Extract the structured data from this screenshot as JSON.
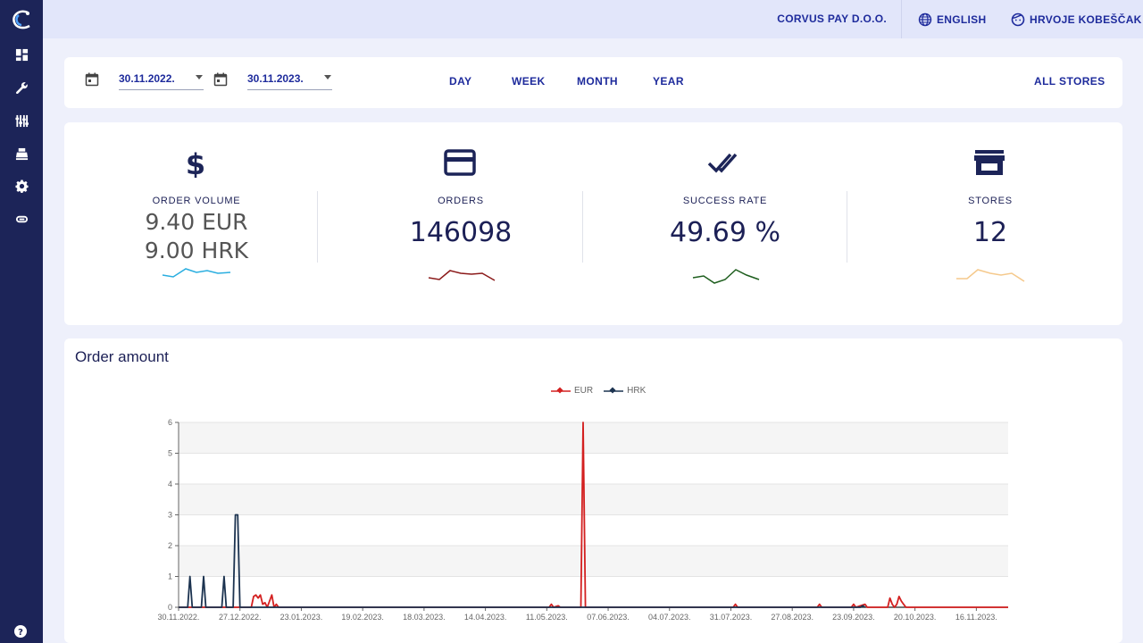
{
  "topbar": {
    "company": "CORVUS PAY D.O.O.",
    "language": "ENGLISH",
    "user": "HRVOJE KOBEŠČAK"
  },
  "sidebar": {
    "items": [
      {
        "name": "dashboard-icon"
      },
      {
        "name": "wrench-icon"
      },
      {
        "name": "sliders-icon"
      },
      {
        "name": "cash-register-icon"
      },
      {
        "name": "gear-icon"
      },
      {
        "name": "link-icon"
      }
    ],
    "help": "help-icon"
  },
  "filters": {
    "date_from": "30.11.2022.",
    "date_to": "30.11.2023.",
    "periods": [
      "DAY",
      "WEEK",
      "MONTH",
      "YEAR"
    ],
    "stores": "ALL STORES"
  },
  "stats": {
    "order_volume": {
      "label": "ORDER VOLUME",
      "value_eur": "9.40 EUR",
      "value_hrk": "9.00 HRK",
      "color": "#2aaee0"
    },
    "orders": {
      "label": "ORDERS",
      "value": "146098",
      "color": "#8b1a1a"
    },
    "success_rate": {
      "label": "SUCCESS RATE",
      "value": "49.69 %",
      "color": "#1e5e1e"
    },
    "stores": {
      "label": "STORES",
      "value": "12",
      "color": "#f5c98c"
    }
  },
  "chart": {
    "title": "Order amount"
  },
  "chart_data": {
    "type": "line",
    "legend": [
      "EUR",
      "HRK"
    ],
    "legend_position": "top-center",
    "ylim": [
      0,
      6
    ],
    "yticks": [
      0,
      1,
      2,
      3,
      4,
      5,
      6
    ],
    "x_tick_labels": [
      "30.11.2022.",
      "27.12.2022.",
      "23.01.2023.",
      "19.02.2023.",
      "18.03.2023.",
      "14.04.2023.",
      "11.05.2023.",
      "07.06.2023.",
      "04.07.2023.",
      "31.07.2023.",
      "27.08.2023.",
      "23.09.2023.",
      "20.10.2023.",
      "16.11.2023."
    ],
    "series": [
      {
        "name": "EUR",
        "color": "#d32020",
        "points": [
          [
            "2022-11-30",
            0
          ],
          [
            "2023-01-01",
            0
          ],
          [
            "2023-01-02",
            0.35
          ],
          [
            "2023-01-03",
            0.4
          ],
          [
            "2023-01-04",
            0.3
          ],
          [
            "2023-01-05",
            0.4
          ],
          [
            "2023-01-06",
            0.1
          ],
          [
            "2023-01-07",
            0.15
          ],
          [
            "2023-01-08",
            0
          ],
          [
            "2023-01-10",
            0.4
          ],
          [
            "2023-01-11",
            0
          ],
          [
            "2023-01-12",
            0.1
          ],
          [
            "2023-01-13",
            0
          ],
          [
            "2023-05-12",
            0
          ],
          [
            "2023-05-13",
            0.1
          ],
          [
            "2023-05-14",
            0
          ],
          [
            "2023-05-16",
            0.05
          ],
          [
            "2023-05-17",
            0
          ],
          [
            "2023-05-26",
            0
          ],
          [
            "2023-05-27",
            6
          ],
          [
            "2023-05-28",
            0
          ],
          [
            "2023-08-01",
            0
          ],
          [
            "2023-08-02",
            0.1
          ],
          [
            "2023-08-03",
            0
          ],
          [
            "2023-09-07",
            0
          ],
          [
            "2023-09-08",
            0.1
          ],
          [
            "2023-09-09",
            0
          ],
          [
            "2023-09-22",
            0
          ],
          [
            "2023-09-23",
            0.1
          ],
          [
            "2023-09-24",
            0
          ],
          [
            "2023-09-28",
            0.1
          ],
          [
            "2023-09-29",
            0
          ],
          [
            "2023-10-08",
            0
          ],
          [
            "2023-10-09",
            0.3
          ],
          [
            "2023-10-10",
            0.1
          ],
          [
            "2023-10-11",
            0
          ],
          [
            "2023-10-12",
            0.1
          ],
          [
            "2023-10-13",
            0.35
          ],
          [
            "2023-10-14",
            0.2
          ],
          [
            "2023-10-15",
            0.1
          ],
          [
            "2023-10-16",
            0
          ],
          [
            "2023-11-30",
            0
          ]
        ]
      },
      {
        "name": "HRK",
        "color": "#1c3350",
        "points": [
          [
            "2022-11-30",
            0
          ],
          [
            "2022-12-04",
            0
          ],
          [
            "2022-12-05",
            1
          ],
          [
            "2022-12-06",
            0
          ],
          [
            "2022-12-10",
            0
          ],
          [
            "2022-12-11",
            1
          ],
          [
            "2022-12-12",
            0
          ],
          [
            "2022-12-19",
            0
          ],
          [
            "2022-12-20",
            1
          ],
          [
            "2022-12-21",
            0
          ],
          [
            "2022-12-24",
            0
          ],
          [
            "2022-12-25",
            3
          ],
          [
            "2022-12-26",
            3
          ],
          [
            "2022-12-27",
            0
          ],
          [
            "2022-12-30",
            0
          ],
          [
            "2023-09-26",
            0
          ],
          [
            "2023-09-27",
            0.05
          ],
          [
            "2023-09-28",
            0
          ]
        ]
      }
    ]
  }
}
